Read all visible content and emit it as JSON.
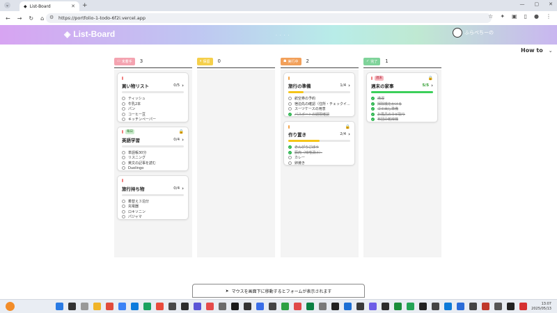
{
  "browser": {
    "tab_title": "List-Board",
    "url": "https://portfolio-1-todo-6f2i.vercel.app"
  },
  "header": {
    "logo": "List-Board",
    "username": "ふらぺちーの"
  },
  "howto": "How to",
  "columns": [
    {
      "label": "未着手",
      "count": "3",
      "color": "#f4a3b0",
      "cards": [
        {
          "title": "買い物リスト",
          "progress": "0/5",
          "fill": 0,
          "tag": "",
          "locked": false,
          "prio": "red",
          "items": [
            {
              "t": "ティッシュ",
              "d": false
            },
            {
              "t": "牛乳2本",
              "d": false
            },
            {
              "t": "パン",
              "d": false
            },
            {
              "t": "コーヒー豆",
              "d": false
            },
            {
              "t": "キッチンペーパー",
              "d": false
            }
          ]
        },
        {
          "title": "英語学習",
          "progress": "0/4",
          "fill": 0,
          "tag": "毎日",
          "tag_color": "green",
          "locked": true,
          "prio": "red",
          "items": [
            {
              "t": "単語帳30分",
              "d": false
            },
            {
              "t": "リスニング",
              "d": false
            },
            {
              "t": "英文の記事を読む",
              "d": false
            },
            {
              "t": "Duolingo",
              "d": false
            }
          ]
        },
        {
          "title": "旅行持ち物",
          "progress": "0/4",
          "fill": 0,
          "tag": "",
          "locked": false,
          "prio": "red",
          "items": [
            {
              "t": "着替え３泊分",
              "d": false
            },
            {
              "t": "充電器",
              "d": false
            },
            {
              "t": "ロキソニン",
              "d": false
            },
            {
              "t": "パジャマ",
              "d": false
            }
          ]
        }
      ]
    },
    {
      "label": "保留",
      "count": "0",
      "color": "#f5cf4a",
      "cards": []
    },
    {
      "label": "実行中",
      "count": "2",
      "color": "#f2a05a",
      "cards": [
        {
          "title": "旅行の準備",
          "progress": "1/4",
          "fill": 0.25,
          "tag": "",
          "locked": false,
          "prio": "orange",
          "items": [
            {
              "t": "航空券の予約",
              "d": false
            },
            {
              "t": "宿泊先の確認（住所・チェックイ...",
              "d": false
            },
            {
              "t": "スーツケースの用意",
              "d": false
            },
            {
              "t": "パスポートの期限確認",
              "d": true
            }
          ]
        },
        {
          "title": "作り置き",
          "progress": "2/4",
          "fill": 0.5,
          "tag": "",
          "locked": true,
          "prio": "orange",
          "items": [
            {
              "t": "きんぴらごぼう",
              "d": true
            },
            {
              "t": "豚肉（味噌漬け）",
              "d": true
            },
            {
              "t": "カレー",
              "d": false
            },
            {
              "t": "卵焼き",
              "d": false
            }
          ]
        }
      ]
    },
    {
      "label": "完了",
      "count": "1",
      "color": "#7fd39a",
      "cards": [
        {
          "title": "週末の家事",
          "progress": "5/5",
          "fill": 1,
          "tag": "週末",
          "tag_color": "red",
          "locked": true,
          "prio": "red",
          "items": [
            {
              "t": "洗濯",
              "d": true
            },
            {
              "t": "掃除機をかける",
              "d": true
            },
            {
              "t": "ゴミ出し準備",
              "d": true
            },
            {
              "t": "お風呂のカビ取り",
              "d": true
            },
            {
              "t": "布団の乾燥機",
              "d": true
            }
          ]
        }
      ]
    }
  ],
  "hint": "マウスを画面下に移動するとフォームが表示されます",
  "clock": {
    "time": "13:07",
    "date": "2025/05/13"
  }
}
